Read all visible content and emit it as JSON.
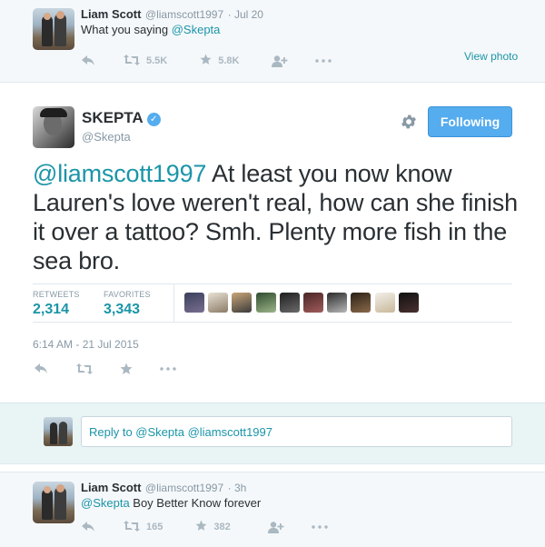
{
  "top_tweet": {
    "name": "Liam Scott",
    "handle": "@liamscott1997",
    "time": "· Jul 20",
    "text_prefix": "What you saying ",
    "text_mention": "@Skepta",
    "retweets": "5.5K",
    "favorites": "5.8K",
    "view_photo": "View photo"
  },
  "main_tweet": {
    "name": "SKEPTA",
    "handle": "@Skepta",
    "verified_glyph": "✓",
    "follow_label": "Following",
    "text_mention": "@liamscott1997",
    "text_body": " At least you now know Lauren's love weren't real, how can she finish it over a tattoo? Smh. Plenty more fish in the sea bro.",
    "retweets_label": "RETWEETS",
    "retweets_value": "2,314",
    "favorites_label": "FAVORITES",
    "favorites_value": "3,343",
    "timestamp": "6:14 AM - 21 Jul 2015",
    "favoriter_count": 10
  },
  "reply_box": {
    "placeholder": "Reply to @Skepta @liamscott1997"
  },
  "bottom_tweet": {
    "name": "Liam Scott",
    "handle": "@liamscott1997",
    "time": "· 3h",
    "text_mention": "@Skepta",
    "text_body": " Boy Better Know forever",
    "retweets": "165",
    "favorites": "382"
  },
  "colors": {
    "link": "#1b95a8",
    "button": "#55acee",
    "icon": "#aab8c2",
    "reply_bg": "#e9f4f5"
  },
  "icons": [
    "reply-icon",
    "retweet-icon",
    "star-icon",
    "follow-user-icon",
    "more-icon",
    "gear-icon",
    "verified-icon"
  ]
}
